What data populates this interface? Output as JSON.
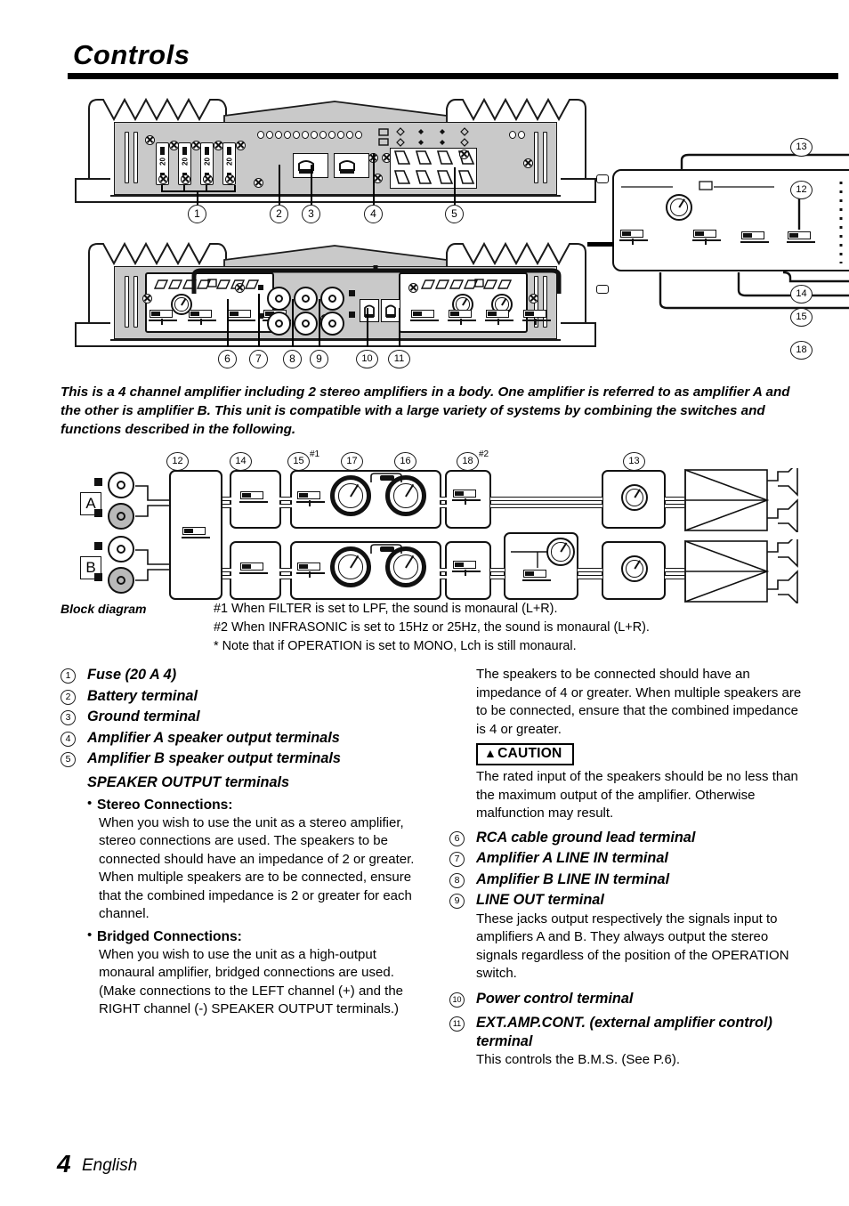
{
  "header": {
    "title": "Controls"
  },
  "intro": "This is a 4 channel amplifier including 2 stereo amplifiers in a body. One amplifier is referred to as amplifier A and the other is amplifier B. This unit is compatible with a large variety of systems by combining the switches and functions described in the following.",
  "top_view": {
    "fuse_rating": "20",
    "callouts": [
      "1",
      "2",
      "3",
      "4",
      "5"
    ]
  },
  "bottom_view": {
    "callouts": [
      "6",
      "7",
      "8",
      "9",
      "10",
      "11"
    ]
  },
  "side_panel": {
    "callouts": [
      "13",
      "12",
      "14",
      "15",
      "18"
    ]
  },
  "block_diagram": {
    "caption": "Block diagram",
    "channel_labels": [
      "A",
      "B"
    ],
    "callouts": [
      "12",
      "14",
      "15",
      "17",
      "16",
      "18",
      "13"
    ],
    "superscripts": {
      "after_15": "#1",
      "after_18": "#2"
    },
    "notes": [
      "#1 When FILTER is set to LPF, the sound is monaural (L+R).",
      "#2 When INFRASONIC is set to 15Hz or 25Hz, the sound is monaural (L+R).",
      "*  Note that if OPERATION is set to MONO, Lch is still monaural."
    ]
  },
  "left_column": {
    "items": [
      {
        "num": "1",
        "head": "Fuse (20 A    4)"
      },
      {
        "num": "2",
        "head": "Battery terminal"
      },
      {
        "num": "3",
        "head": "Ground terminal"
      },
      {
        "num": "4",
        "head": "Amplifier A speaker output terminals"
      },
      {
        "num": "5",
        "head": "Amplifier B speaker output terminals"
      }
    ],
    "speaker_output_heading": "SPEAKER OUTPUT terminals",
    "bullets": [
      {
        "title": "Stereo Connections:",
        "text": "When you wish to use the unit as a stereo amplifier, stereo connections are used. The speakers to be connected should have an impedance of 2    or greater. When multiple speakers are to be connected, ensure that the combined impedance is 2    or greater for each channel."
      },
      {
        "title": "Bridged Connections:",
        "text": "When you wish to use the unit as a high-output monaural amplifier, bridged connections are used. (Make connections to the LEFT channel (+) and the RIGHT channel (-) SPEAKER OUTPUT terminals.)"
      }
    ]
  },
  "right_column": {
    "intro_text": "The speakers to be connected should have an impedance of 4    or greater. When multiple speakers are to be connected, ensure that the combined impedance is 4    or greater.",
    "caution": {
      "triangle": "warning-triangle-icon",
      "label": "CAUTION",
      "text": "The rated input of the speakers should be no less than the maximum output of the amplifier. Otherwise malfunction may result."
    },
    "items": [
      {
        "num": "6",
        "head": "RCA cable ground lead terminal",
        "body": ""
      },
      {
        "num": "7",
        "head": "Amplifier A LINE IN terminal",
        "body": ""
      },
      {
        "num": "8",
        "head": "Amplifier B LINE IN terminal",
        "body": ""
      },
      {
        "num": "9",
        "head": "LINE OUT terminal",
        "body": "These jacks output respectively the signals input to amplifiers A and B. They always output the stereo signals regardless of the position of the OPERATION switch."
      },
      {
        "num": "10",
        "head": "Power control terminal",
        "body": ""
      },
      {
        "num": "11",
        "head": "EXT.AMP.CONT. (external amplifier control) terminal",
        "body": "This controls the B.M.S. (See P.6)."
      }
    ]
  },
  "footer": {
    "page_number": "4",
    "language": "English"
  },
  "colors": {
    "chassis": "#c9c9c9",
    "ink": "#000000"
  }
}
